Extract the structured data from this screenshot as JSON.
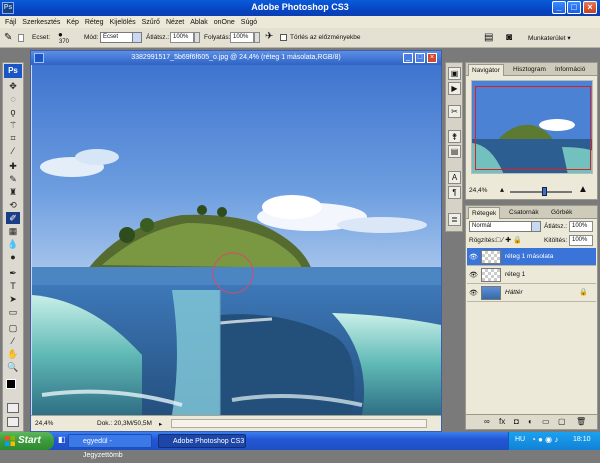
{
  "window": {
    "title": "Adobe Photoshop CS3",
    "logo": "Ps"
  },
  "menu": [
    "Fájl",
    "Szerkesztés",
    "Kép",
    "Réteg",
    "Kijelölés",
    "Szűrő",
    "Nézet",
    "Ablak",
    "onOne",
    "Súgó"
  ],
  "options": {
    "brush_label": "Ecset:",
    "brush_size": "370",
    "mode_label": "Mód:",
    "mode_value": "Ecset",
    "opacity_label": "Átlátsz.:",
    "opacity_value": "100%",
    "flow_label": "Folyatás:",
    "flow_value": "100%",
    "erase_history_label": "Törlés az előzményekbe",
    "workspace_label": "Munkaterület"
  },
  "document": {
    "title": "3382991517_5b69f6f605_o.jpg @ 24,4% (réteg 1 másolata,RGB/8)",
    "zoom": "24,4%",
    "doc_size": "Dok.: 20,3M/50,5M"
  },
  "navigator": {
    "tabs": [
      "Navigátor",
      "Hisztogram",
      "Információ"
    ],
    "zoom": "24,4%"
  },
  "layers": {
    "tabs": [
      "Rétegek",
      "Csatornák",
      "Görbék"
    ],
    "blend_mode": "Normál",
    "opacity_label": "Átlátsz.:",
    "opacity_value": "100%",
    "lock_label": "Rögzítés:",
    "fill_label": "Kitöltés:",
    "fill_value": "100%",
    "items": [
      {
        "name": "réteg 1 másolata",
        "selected": true
      },
      {
        "name": "réteg 1",
        "selected": false
      },
      {
        "name": "Háttér",
        "selected": false
      }
    ]
  },
  "toolbox": {
    "badge": "Ps",
    "tools": [
      "move-tool",
      "marquee-tool",
      "lasso-tool",
      "magic-wand-tool",
      "crop-tool",
      "eyedropper-tool",
      "healing-tool",
      "brush-tool",
      "stamp-tool",
      "history-brush-tool",
      "eraser-tool",
      "gradient-tool",
      "blur-tool",
      "dodge-tool",
      "pen-tool",
      "type-tool",
      "path-select-tool",
      "shape-tool",
      "notes-tool",
      "eyedropper2-tool",
      "hand-tool",
      "zoom-tool"
    ],
    "active": "eraser-tool"
  },
  "taskbar": {
    "start": "Start",
    "items": [
      "egyedül - Jegyzettömb",
      "Adobe Photoshop CS3"
    ],
    "tray_lang": "HU",
    "clock": "18:10"
  },
  "colors": {
    "titlebar": "#0a5bd9",
    "selection": "#3a74d8",
    "taskbar": "#2357d6",
    "start": "#3b9b3b"
  }
}
